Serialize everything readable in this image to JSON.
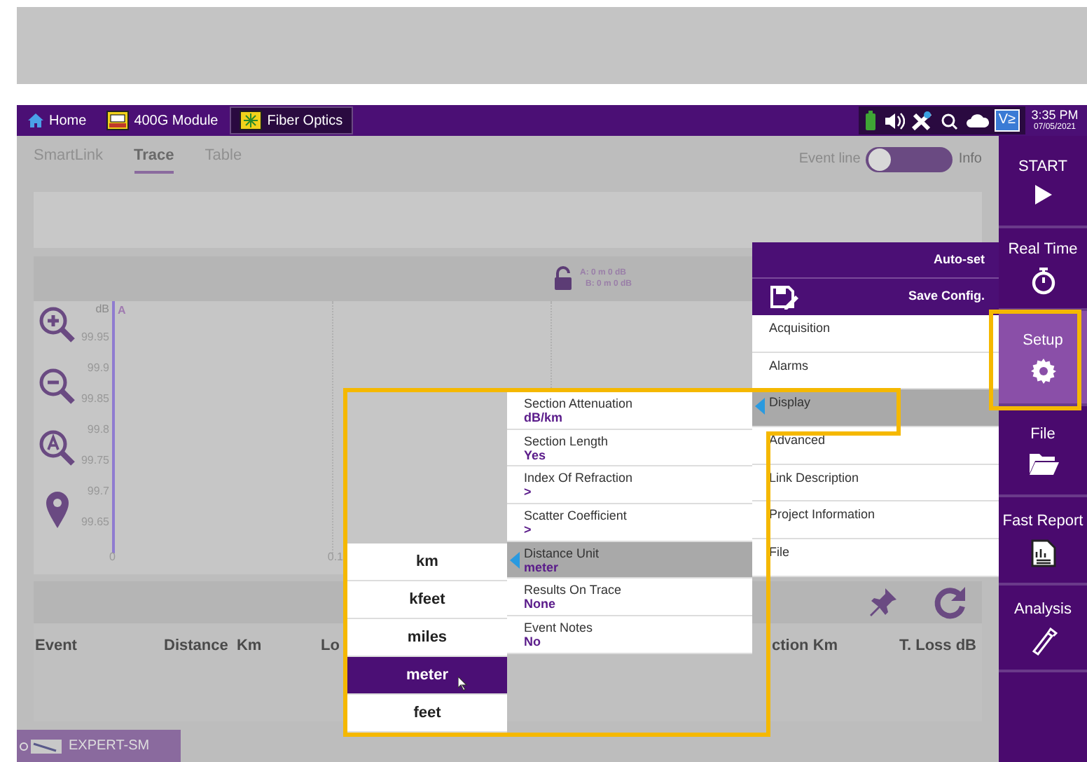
{
  "top_bar": {
    "tabs": [
      {
        "label": "Home",
        "kind": "home",
        "selected": false
      },
      {
        "label": "400G Module",
        "kind": "module",
        "selected": false
      },
      {
        "label": "Fiber Optics",
        "kind": "fiber",
        "selected": true
      }
    ],
    "time": "3:35 PM",
    "date": "07/05/2021",
    "badge": "V≥"
  },
  "view_tabs": [
    {
      "label": "SmartLink",
      "selected": false
    },
    {
      "label": "Trace",
      "selected": true
    },
    {
      "label": "Table",
      "selected": false
    }
  ],
  "event_line": {
    "label": "Event line",
    "on": false,
    "info": "Info"
  },
  "markers": {
    "a": "A: 0 m 0 dB",
    "b": "B: 0 m 0 dB"
  },
  "plot": {
    "y_unit": "dB",
    "cursor": "A",
    "y_ticks": [
      "99.95",
      "99.9",
      "99.85",
      "99.8",
      "99.75",
      "99.7",
      "99.65"
    ],
    "x_ticks": [
      "0",
      "0.1"
    ]
  },
  "events_table": {
    "columns": [
      {
        "label": "Event"
      },
      {
        "label": "Distance  Km"
      },
      {
        "label": "Lo"
      },
      {
        "label": "ction Km"
      },
      {
        "label": "T. Loss dB"
      }
    ]
  },
  "sidebar": [
    {
      "label": "START",
      "kind": "play",
      "selected": false
    },
    {
      "label": "Real Time",
      "kind": "stopwatch",
      "selected": false
    },
    {
      "label": "Setup",
      "kind": "gear",
      "selected": true
    },
    {
      "label": "File",
      "kind": "folder",
      "selected": false
    },
    {
      "label": "Fast Report",
      "kind": "report",
      "selected": false
    },
    {
      "label": "Analysis",
      "kind": "tool",
      "selected": false
    }
  ],
  "setup_menu": {
    "auto_set": "Auto-set",
    "save_config": "Save Config.",
    "items": [
      {
        "label": "Acquisition",
        "selected": false
      },
      {
        "label": "Alarms",
        "selected": false
      },
      {
        "label": "Display",
        "selected": true
      },
      {
        "label": "Advanced",
        "selected": false
      },
      {
        "label": "Link Description",
        "selected": false
      },
      {
        "label": "Project Information",
        "selected": false
      },
      {
        "label": "File",
        "selected": false
      }
    ]
  },
  "display_menu": {
    "items": [
      {
        "label": "Section Attenuation",
        "value": "dB/km",
        "selected": false
      },
      {
        "label": "Section Length",
        "value": "Yes",
        "selected": false
      },
      {
        "label": "Index Of Refraction",
        "value": ">",
        "selected": false
      },
      {
        "label": "Scatter Coefficient",
        "value": ">",
        "selected": false
      },
      {
        "label": "Distance Unit",
        "value": "meter",
        "selected": true
      },
      {
        "label": "Results On Trace",
        "value": "None",
        "selected": false
      },
      {
        "label": "Event Notes",
        "value": "No",
        "selected": false
      }
    ]
  },
  "unit_list": [
    {
      "label": "km",
      "selected": false
    },
    {
      "label": "kfeet",
      "selected": false
    },
    {
      "label": "miles",
      "selected": false
    },
    {
      "label": "meter",
      "selected": true
    },
    {
      "label": "feet",
      "selected": false
    }
  ],
  "bottom_tab": {
    "label": "EXPERT-SM"
  }
}
